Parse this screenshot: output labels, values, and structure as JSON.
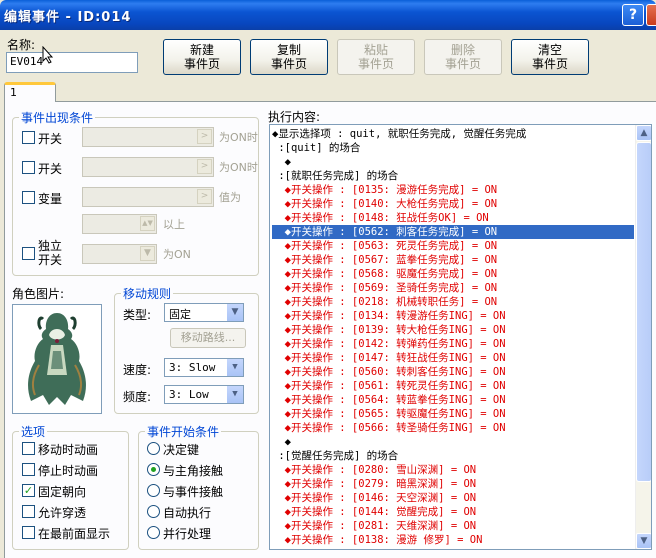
{
  "window": {
    "title": "编辑事件 - ID:014",
    "help_glyph": "?",
    "close_glyph": "×"
  },
  "name": {
    "label": "名称:",
    "value": "EV014"
  },
  "toolbar": {
    "new": [
      "新建",
      "事件页"
    ],
    "copy": [
      "复制",
      "事件页"
    ],
    "paste": [
      "粘贴",
      "事件页"
    ],
    "delete": [
      "删除",
      "事件页"
    ],
    "clear": [
      "清空",
      "事件页"
    ]
  },
  "tab": "1",
  "conditions": {
    "title": "事件出现条件",
    "switch1": "开关",
    "switch1_suffix": "为ON时",
    "switch2": "开关",
    "switch2_suffix": "为ON时",
    "variable": "变量",
    "variable_suffix": "值为",
    "above": "以上",
    "self_switch": [
      "独立",
      "开关"
    ],
    "self_switch_suffix": "为ON"
  },
  "graphic": {
    "label": "角色图片:"
  },
  "movement": {
    "title": "移动规则",
    "type_label": "类型:",
    "type_value": "固定",
    "route_button": "移动路线...",
    "speed_label": "速度:",
    "speed_value": "3: Slow",
    "freq_label": "频度:",
    "freq_value": "3: Low"
  },
  "options": {
    "title": "选项",
    "items": [
      {
        "label": "移动时动画",
        "checked": false
      },
      {
        "label": "停止时动画",
        "checked": false
      },
      {
        "label": "固定朝向",
        "checked": true
      },
      {
        "label": "允许穿透",
        "checked": false
      },
      {
        "label": "在最前面显示",
        "checked": false
      }
    ]
  },
  "trigger": {
    "title": "事件开始条件",
    "items": [
      {
        "label": "决定键",
        "selected": false
      },
      {
        "label": "与主角接触",
        "selected": true
      },
      {
        "label": "与事件接触",
        "selected": false
      },
      {
        "label": "自动执行",
        "selected": false
      },
      {
        "label": "并行处理",
        "selected": false
      }
    ]
  },
  "contents": {
    "label": "执行内容:",
    "lines": [
      {
        "text": "◆显示选择项 : quit, 就职任务完成, 觉醒任务完成",
        "color": "black"
      },
      {
        "text": " :[quit] 的场合",
        "color": "black"
      },
      {
        "text": "  ◆",
        "color": "black"
      },
      {
        "text": " :[就职任务完成] 的场合",
        "color": "black"
      },
      {
        "text": "  ◆开关操作 : [0135: 漫游任务完成] = ON",
        "color": "red"
      },
      {
        "text": "  ◆开关操作 : [0140: 大枪任务完成] = ON",
        "color": "red"
      },
      {
        "text": "  ◆开关操作 : [0148: 狂战任务OK] = ON",
        "color": "red"
      },
      {
        "text": "  ◆开关操作 : [0562: 刺客任务完成] = ON",
        "color": "selected"
      },
      {
        "text": "  ◆开关操作 : [0563: 死灵任务完成] = ON",
        "color": "red"
      },
      {
        "text": "  ◆开关操作 : [0567: 蓝拳任务完成] = ON",
        "color": "red"
      },
      {
        "text": "  ◆开关操作 : [0568: 驱魔任务完成] = ON",
        "color": "red"
      },
      {
        "text": "  ◆开关操作 : [0569: 圣骑任务完成] = ON",
        "color": "red"
      },
      {
        "text": "  ◆开关操作 : [0218: 机械转职任务] = ON",
        "color": "red"
      },
      {
        "text": "  ◆开关操作 : [0134: 转漫游任务ING] = ON",
        "color": "red"
      },
      {
        "text": "  ◆开关操作 : [0139: 转大枪任务ING] = ON",
        "color": "red"
      },
      {
        "text": "  ◆开关操作 : [0142: 转弹药任务ING] = ON",
        "color": "red"
      },
      {
        "text": "  ◆开关操作 : [0147: 转狂战任务ING] = ON",
        "color": "red"
      },
      {
        "text": "  ◆开关操作 : [0560: 转刺客任务ING] = ON",
        "color": "red"
      },
      {
        "text": "  ◆开关操作 : [0561: 转死灵任务ING] = ON",
        "color": "red"
      },
      {
        "text": "  ◆开关操作 : [0564: 转蓝拳任务ING] = ON",
        "color": "red"
      },
      {
        "text": "  ◆开关操作 : [0565: 转驱魔任务ING] = ON",
        "color": "red"
      },
      {
        "text": "  ◆开关操作 : [0566: 转圣骑任务ING] = ON",
        "color": "red"
      },
      {
        "text": "  ◆",
        "color": "black"
      },
      {
        "text": " :[觉醒任务完成] 的场合",
        "color": "black"
      },
      {
        "text": "  ◆开关操作 : [0280: 雪山深渊] = ON",
        "color": "red"
      },
      {
        "text": "  ◆开关操作 : [0279: 暗黑深渊] = ON",
        "color": "red"
      },
      {
        "text": "  ◆开关操作 : [0146: 天空深渊] = ON",
        "color": "red"
      },
      {
        "text": "  ◆开关操作 : [0144: 觉醒完成] = ON",
        "color": "red"
      },
      {
        "text": "  ◆开关操作 : [0281: 天维深渊] = ON",
        "color": "red"
      },
      {
        "text": "  ◆开关操作 : [0138: 漫游 修罗] = ON",
        "color": "red"
      }
    ]
  }
}
